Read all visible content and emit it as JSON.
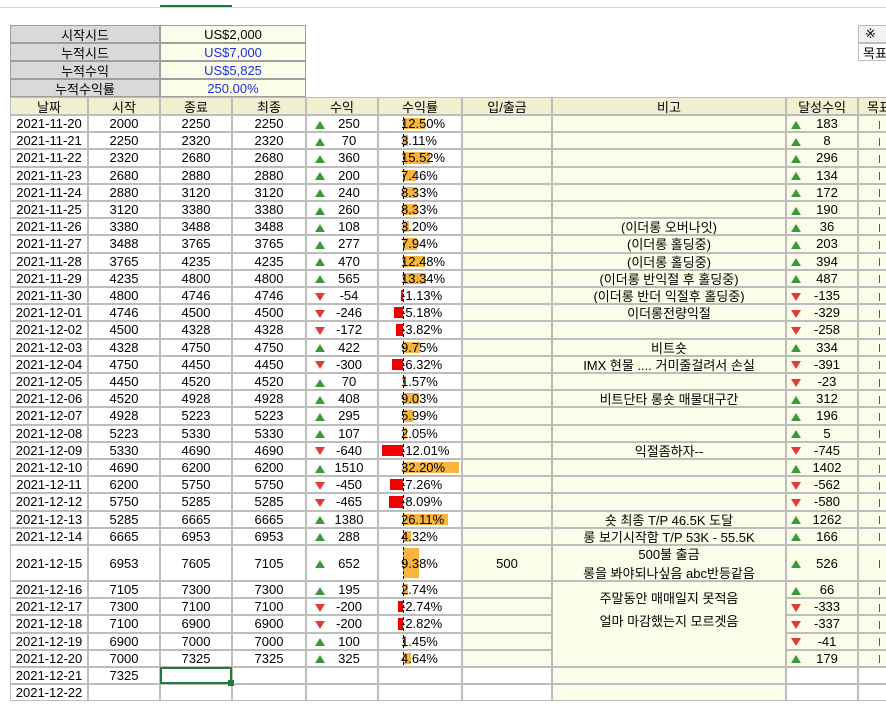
{
  "summary": [
    {
      "label": "시작시드",
      "value": "US$2,000",
      "black": true
    },
    {
      "label": "누적시드",
      "value": "US$7,000",
      "black": false
    },
    {
      "label": "누적수익",
      "value": "US$5,825",
      "black": false
    },
    {
      "label": "누적수익률",
      "value": "250.00%",
      "black": false
    }
  ],
  "side_note": {
    "mark": "※",
    "cut_text": "목표"
  },
  "headers": [
    "날짜",
    "시작",
    "종료",
    "최종",
    "수익",
    "수익률",
    "입/출금",
    "비고",
    "달성수익",
    "목표"
  ],
  "rows": [
    {
      "date": "2021-11-20",
      "start": "2000",
      "end": "2250",
      "final": "2250",
      "profit": "250",
      "dir": "up",
      "rate": "12.50%",
      "rate_val": 12.5,
      "io": "",
      "note": "",
      "goal": "183"
    },
    {
      "date": "2021-11-21",
      "start": "2250",
      "end": "2320",
      "final": "2320",
      "profit": "70",
      "dir": "up",
      "rate": "3.11%",
      "rate_val": 3.11,
      "io": "",
      "note": "",
      "goal": "8"
    },
    {
      "date": "2021-11-22",
      "start": "2320",
      "end": "2680",
      "final": "2680",
      "profit": "360",
      "dir": "up",
      "rate": "15.52%",
      "rate_val": 15.52,
      "io": "",
      "note": "",
      "goal": "296"
    },
    {
      "date": "2021-11-23",
      "start": "2680",
      "end": "2880",
      "final": "2880",
      "profit": "200",
      "dir": "up",
      "rate": "7.46%",
      "rate_val": 7.46,
      "io": "",
      "note": "",
      "goal": "134"
    },
    {
      "date": "2021-11-24",
      "start": "2880",
      "end": "3120",
      "final": "3120",
      "profit": "240",
      "dir": "up",
      "rate": "8.33%",
      "rate_val": 8.33,
      "io": "",
      "note": "",
      "goal": "172"
    },
    {
      "date": "2021-11-25",
      "start": "3120",
      "end": "3380",
      "final": "3380",
      "profit": "260",
      "dir": "up",
      "rate": "8.33%",
      "rate_val": 8.33,
      "io": "",
      "note": "",
      "goal": "190"
    },
    {
      "date": "2021-11-26",
      "start": "3380",
      "end": "3488",
      "final": "3488",
      "profit": "108",
      "dir": "up",
      "rate": "3.20%",
      "rate_val": 3.2,
      "io": "",
      "note": "(이더롱 오버나잇)",
      "goal": "36"
    },
    {
      "date": "2021-11-27",
      "start": "3488",
      "end": "3765",
      "final": "3765",
      "profit": "277",
      "dir": "up",
      "rate": "7.94%",
      "rate_val": 7.94,
      "io": "",
      "note": "(이더롱 홀딩중)",
      "goal": "203"
    },
    {
      "date": "2021-11-28",
      "start": "3765",
      "end": "4235",
      "final": "4235",
      "profit": "470",
      "dir": "up",
      "rate": "12.48%",
      "rate_val": 12.48,
      "io": "",
      "note": "(이더롱 홀딩중)",
      "goal": "394"
    },
    {
      "date": "2021-11-29",
      "start": "4235",
      "end": "4800",
      "final": "4800",
      "profit": "565",
      "dir": "up",
      "rate": "13.34%",
      "rate_val": 13.34,
      "io": "",
      "note": "(이더롱 반익절 후 홀딩중)",
      "goal": "487"
    },
    {
      "date": "2021-11-30",
      "start": "4800",
      "end": "4746",
      "final": "4746",
      "profit": "-54",
      "dir": "down",
      "rate": "-1.13%",
      "rate_val": -1.13,
      "io": "",
      "note": "(이더롱 반더 익절후 홀딩중)",
      "goal": "-135"
    },
    {
      "date": "2021-12-01",
      "start": "4746",
      "end": "4500",
      "final": "4500",
      "profit": "-246",
      "dir": "down",
      "rate": "-5.18%",
      "rate_val": -5.18,
      "io": "",
      "note": "이더롱전량익절",
      "goal": "-329"
    },
    {
      "date": "2021-12-02",
      "start": "4500",
      "end": "4328",
      "final": "4328",
      "profit": "-172",
      "dir": "down",
      "rate": "-3.82%",
      "rate_val": -3.82,
      "io": "",
      "note": "",
      "goal": "-258"
    },
    {
      "date": "2021-12-03",
      "start": "4328",
      "end": "4750",
      "final": "4750",
      "profit": "422",
      "dir": "up",
      "rate": "9.75%",
      "rate_val": 9.75,
      "io": "",
      "note": "비트숏",
      "goal": "334"
    },
    {
      "date": "2021-12-04",
      "start": "4750",
      "end": "4450",
      "final": "4450",
      "profit": "-300",
      "dir": "down",
      "rate": "-6.32%",
      "rate_val": -6.32,
      "io": "",
      "note": "IMX 현물 .... 거미줄걸려서 손실",
      "goal": "-391"
    },
    {
      "date": "2021-12-05",
      "start": "4450",
      "end": "4520",
      "final": "4520",
      "profit": "70",
      "dir": "up",
      "rate": "1.57%",
      "rate_val": 1.57,
      "io": "",
      "note": "",
      "goal": "-23"
    },
    {
      "date": "2021-12-06",
      "start": "4520",
      "end": "4928",
      "final": "4928",
      "profit": "408",
      "dir": "up",
      "rate": "9.03%",
      "rate_val": 9.03,
      "io": "",
      "note": "비트단타 롱숏 매물대구간",
      "goal": "312"
    },
    {
      "date": "2021-12-07",
      "start": "4928",
      "end": "5223",
      "final": "5223",
      "profit": "295",
      "dir": "up",
      "rate": "5.99%",
      "rate_val": 5.99,
      "io": "",
      "note": "",
      "goal": "196"
    },
    {
      "date": "2021-12-08",
      "start": "5223",
      "end": "5330",
      "final": "5330",
      "profit": "107",
      "dir": "up",
      "rate": "2.05%",
      "rate_val": 2.05,
      "io": "",
      "note": "",
      "goal": "5"
    },
    {
      "date": "2021-12-09",
      "start": "5330",
      "end": "4690",
      "final": "4690",
      "profit": "-640",
      "dir": "down",
      "rate": "-12.01%",
      "rate_val": -12.01,
      "io": "",
      "note": "익절좀하자--",
      "goal": "-745"
    },
    {
      "date": "2021-12-10",
      "start": "4690",
      "end": "6200",
      "final": "6200",
      "profit": "1510",
      "dir": "up",
      "rate": "32.20%",
      "rate_val": 32.2,
      "io": "",
      "note": "",
      "goal": "1402"
    },
    {
      "date": "2021-12-11",
      "start": "6200",
      "end": "5750",
      "final": "5750",
      "profit": "-450",
      "dir": "down",
      "rate": "-7.26%",
      "rate_val": -7.26,
      "io": "",
      "note": "",
      "goal": "-562"
    },
    {
      "date": "2021-12-12",
      "start": "5750",
      "end": "5285",
      "final": "5285",
      "profit": "-465",
      "dir": "down",
      "rate": "-8.09%",
      "rate_val": -8.09,
      "io": "",
      "note": "",
      "goal": "-580"
    },
    {
      "date": "2021-12-13",
      "start": "5285",
      "end": "6665",
      "final": "6665",
      "profit": "1380",
      "dir": "up",
      "rate": "26.11%",
      "rate_val": 26.11,
      "io": "",
      "note": "숏 최종 T/P 46.5K 도달",
      "goal": "1262"
    },
    {
      "date": "2021-12-14",
      "start": "6665",
      "end": "6953",
      "final": "6953",
      "profit": "288",
      "dir": "up",
      "rate": "4.32%",
      "rate_val": 4.32,
      "io": "",
      "note": "롱 보기시작함 T/P 53K - 55.5K",
      "goal": "166"
    },
    {
      "date": "2021-12-15",
      "start": "6953",
      "end": "7605",
      "final": "7105",
      "profit": "652",
      "dir": "up",
      "rate": "9.38%",
      "rate_val": 9.38,
      "io": "500",
      "note": "500불 출금",
      "note2": "롱을 봐야되나싶음 abc반등같음",
      "goal": "526",
      "tall": true
    },
    {
      "date": "2021-12-16",
      "start": "7105",
      "end": "7300",
      "final": "7300",
      "profit": "195",
      "dir": "up",
      "rate": "2.74%",
      "rate_val": 2.74,
      "io": "",
      "note": "",
      "goal": "66"
    },
    {
      "date": "2021-12-17",
      "start": "7300",
      "end": "7100",
      "final": "7100",
      "profit": "-200",
      "dir": "down",
      "rate": "-2.74%",
      "rate_val": -2.74,
      "io": "",
      "note": "",
      "goal": "-333"
    },
    {
      "date": "2021-12-18",
      "start": "7100",
      "end": "6900",
      "final": "6900",
      "profit": "-200",
      "dir": "down",
      "rate": "-2.82%",
      "rate_val": -2.82,
      "io": "",
      "note": "",
      "goal": "-337"
    },
    {
      "date": "2021-12-19",
      "start": "6900",
      "end": "7000",
      "final": "7000",
      "profit": "100",
      "dir": "up",
      "rate": "1.45%",
      "rate_val": 1.45,
      "io": "",
      "note": "",
      "goal": "-41"
    },
    {
      "date": "2021-12-20",
      "start": "7000",
      "end": "7325",
      "final": "7325",
      "profit": "325",
      "dir": "up",
      "rate": "4.64%",
      "rate_val": 4.64,
      "io": "",
      "note": "",
      "goal": "179"
    },
    {
      "date": "2021-12-21",
      "start": "7325",
      "end": "",
      "final": "",
      "profit": "",
      "dir": "",
      "rate": "",
      "rate_val": 0,
      "io": "",
      "note": "",
      "goal": "",
      "blank": true
    },
    {
      "date": "2021-12-22",
      "start": "",
      "end": "",
      "final": "",
      "profit": "",
      "dir": "",
      "rate": "",
      "rate_val": 0,
      "io": "",
      "note": "",
      "goal": "",
      "blank": true
    }
  ],
  "merged_note": {
    "line1": "주말동안 매매일지 못적음",
    "line2": "얼마 마감했는지 모르겟음"
  },
  "colors": {
    "pos_bar": "#f7b540",
    "neg_bar": "#f00000",
    "up": "#3a9a3a",
    "down": "#e03a3a",
    "value_blue": "#1f2ee0"
  }
}
